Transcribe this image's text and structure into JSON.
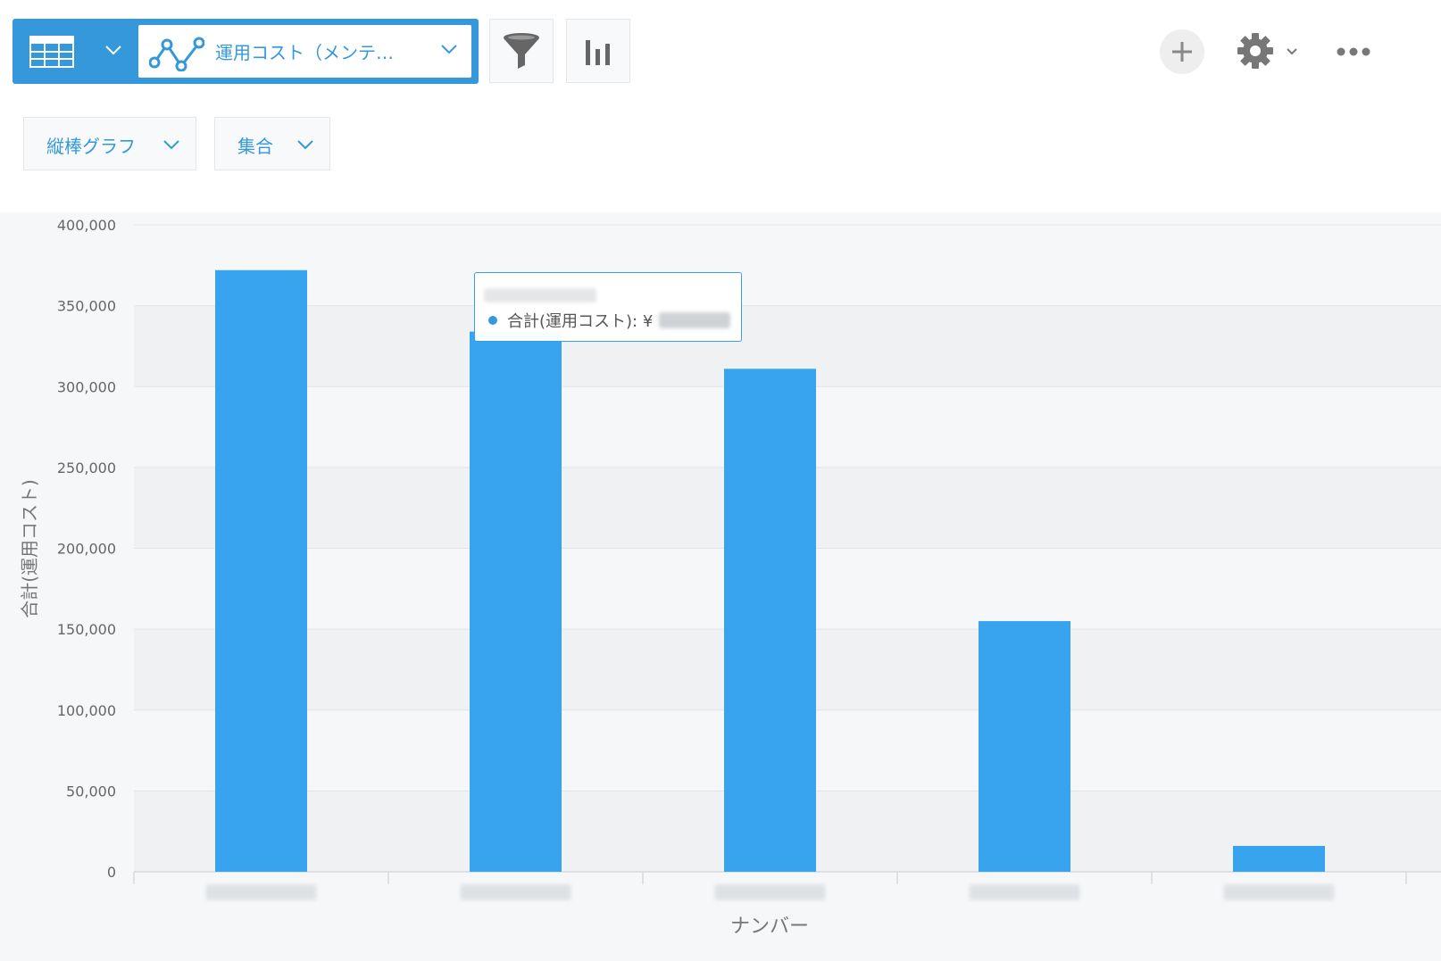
{
  "toolbar": {
    "graph_select_label": "運用コスト（メンテ…",
    "icons": [
      "table-view-icon",
      "graph-icon",
      "filter-icon",
      "chart-settings-icon",
      "add-icon",
      "gear-icon",
      "more-icon"
    ]
  },
  "chart_options": {
    "type_label": "縦棒グラフ",
    "aggregate_label": "集合"
  },
  "tooltip": {
    "series_label": "合計(運用コスト): ¥"
  },
  "colors": {
    "accent": "#3498db",
    "bar": "#38a4f0",
    "panel_bg": "#f5f7f8",
    "band": "#eff1f3"
  },
  "chart_data": {
    "type": "bar",
    "categories": [
      "",
      "",
      "",
      "",
      ""
    ],
    "series": [
      {
        "values": [
          372000,
          334000,
          311000,
          155000,
          16000
        ]
      }
    ],
    "xlabel": "ナンバー",
    "ylabel": "合計(運用コスト)",
    "ylim": [
      0,
      400000
    ],
    "yticks": [
      "0",
      "50,000",
      "100,000",
      "150,000",
      "200,000",
      "250,000",
      "300,000",
      "350,000",
      "400,000"
    ],
    "category_labels_blurred": true,
    "grid": true
  }
}
